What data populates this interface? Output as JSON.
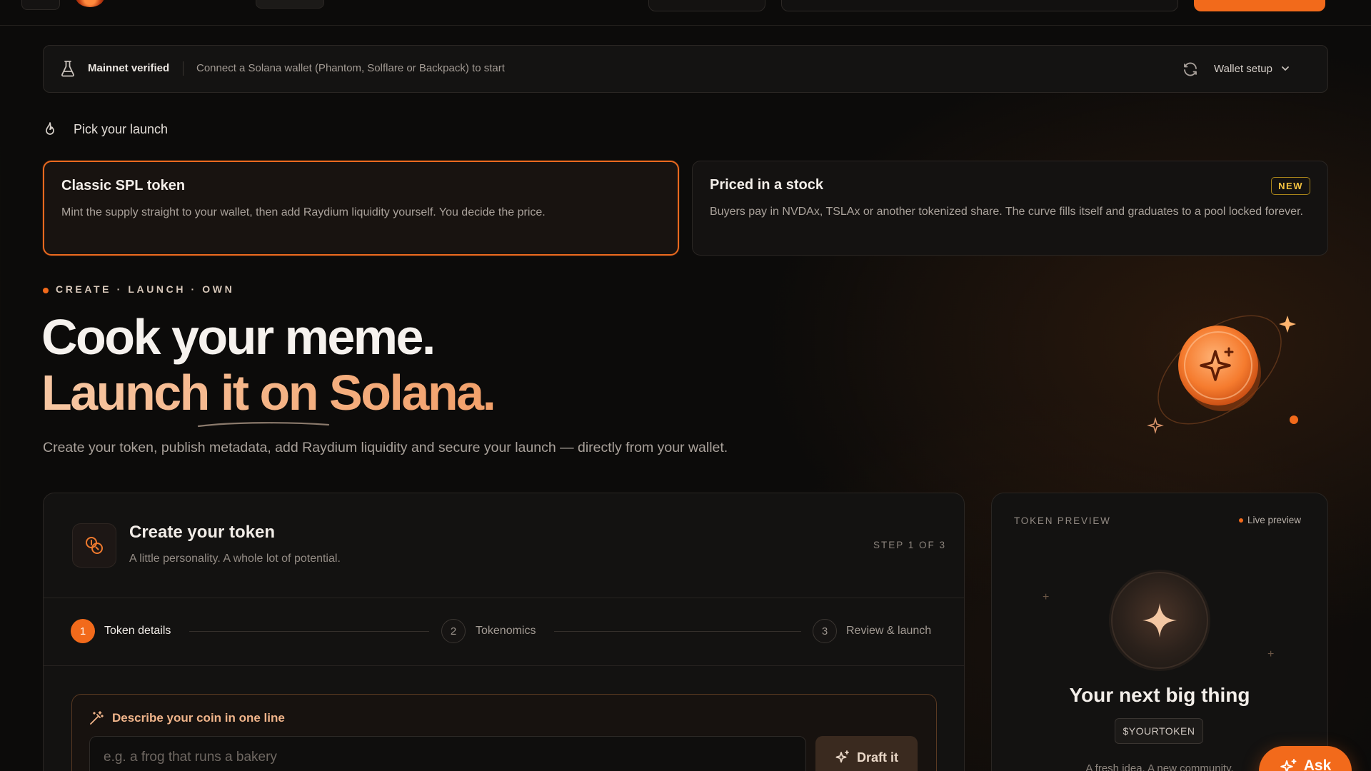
{
  "banner": {
    "status": "Mainnet verified",
    "note": "Connect a Solana wallet (Phantom, Solflare or Backpack) to start",
    "wallet_setup": "Wallet setup"
  },
  "pick": {
    "title": "Pick your launch",
    "options": [
      {
        "title": "Classic SPL token",
        "description": "Mint the supply straight to your wallet, then add Raydium liquidity yourself. You decide the price.",
        "selected": true
      },
      {
        "title": "Priced in a stock",
        "description": "Buyers pay in NVDAx, TSLAx or another tokenized share. The curve fills itself and graduates to a pool locked forever.",
        "badge": "NEW",
        "selected": false
      }
    ]
  },
  "hero": {
    "eyebrow": "CREATE · LAUNCH · OWN",
    "line1": "Cook your meme.",
    "line2": "Launch it on Solana.",
    "subtitle": "Create your token, publish metadata, add Raydium liquidity and secure your launch — directly from your wallet."
  },
  "create": {
    "title": "Create your token",
    "subtitle": "A little personality. A whole lot of potential.",
    "step_indicator": "STEP 1 OF 3",
    "steps": [
      {
        "num": "1",
        "label": "Token details",
        "active": true
      },
      {
        "num": "2",
        "label": "Tokenomics",
        "active": false
      },
      {
        "num": "3",
        "label": "Review & launch",
        "active": false
      }
    ],
    "describe": {
      "title": "Describe your coin in one line",
      "placeholder": "e.g. a frog that runs a bakery",
      "value": "",
      "button": "Draft it"
    }
  },
  "preview": {
    "label": "TOKEN PREVIEW",
    "live": "Live preview",
    "name": "Your next big thing",
    "ticker": "$YOURTOKEN",
    "description": "A fresh idea. A new community."
  },
  "ask": {
    "label": "Ask"
  },
  "colors": {
    "accent": "#f26a1b",
    "background": "#0c0b0a",
    "badge": "#f4c240",
    "hero_gradient": "#f6b98f"
  },
  "icons": [
    "flask-icon",
    "refresh-icon",
    "chevron-down-icon",
    "fire-icon",
    "sparkle-coin-icon",
    "coins-icon",
    "wand-icon",
    "sparkle-icon",
    "star-icon"
  ]
}
